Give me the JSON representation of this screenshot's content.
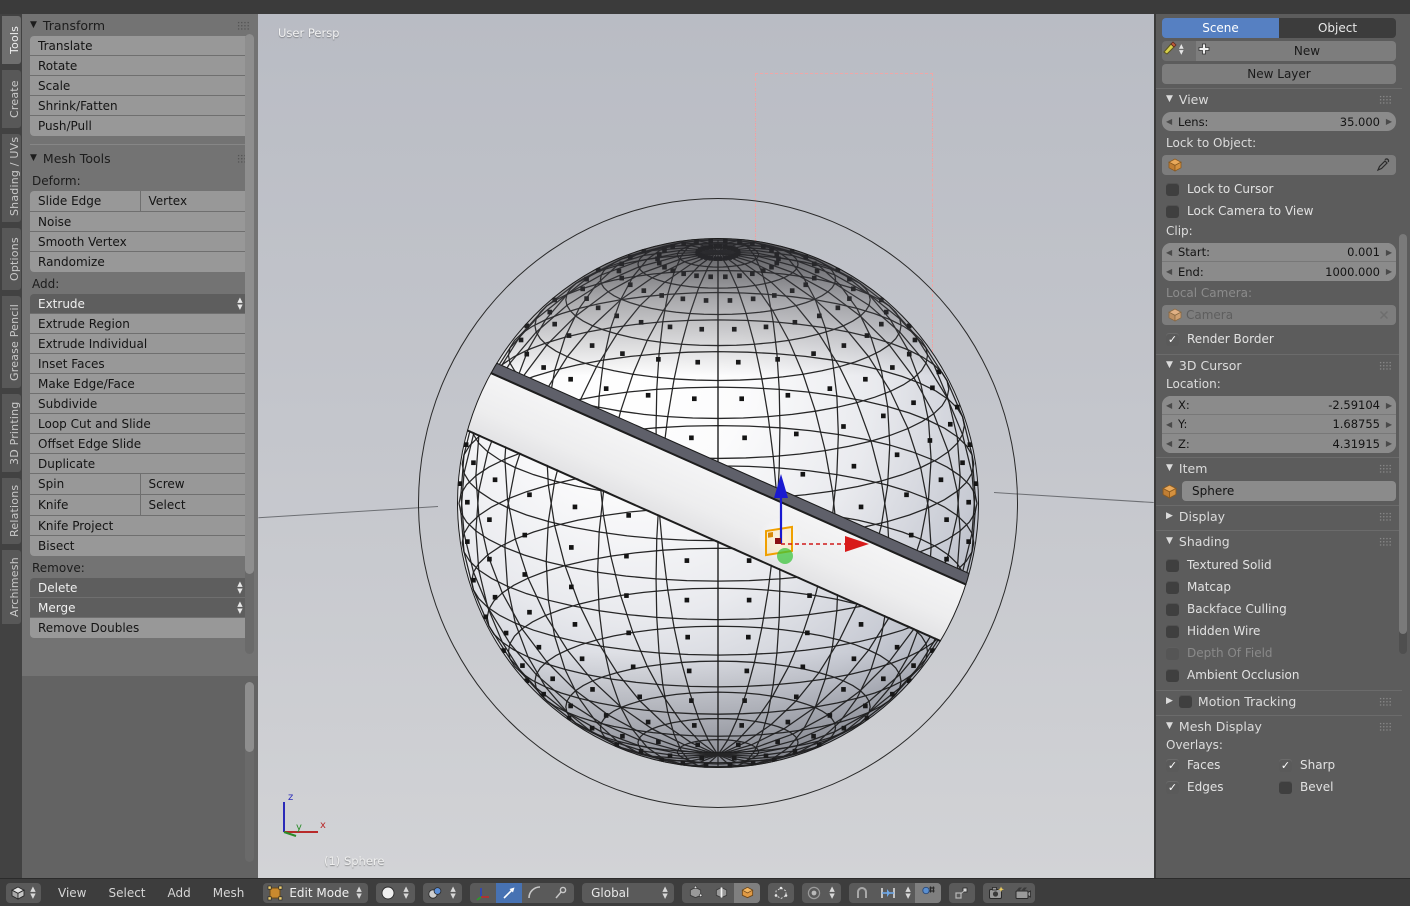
{
  "viewport": {
    "persp_label": "User Persp",
    "object_label": "(1) Sphere",
    "axis": {
      "z": "z",
      "y": "y",
      "x": "x"
    },
    "colors": {
      "axis_x": "#c04040",
      "axis_y": "#3f9e3f",
      "axis_z": "#3a3ac0",
      "render_border": "#e03a3a",
      "select_outline": "#f0a000",
      "background": "#c4c6cc"
    }
  },
  "left_tabs": [
    {
      "label": "Tools",
      "active": true
    },
    {
      "label": "Create",
      "active": false
    },
    {
      "label": "Shading / UVs",
      "active": false
    },
    {
      "label": "Options",
      "active": false
    },
    {
      "label": "Grease Pencil",
      "active": false
    },
    {
      "label": "3D Printing",
      "active": false
    },
    {
      "label": "Relations",
      "active": false
    },
    {
      "label": "Archimesh",
      "active": false
    }
  ],
  "toolshelf": {
    "transform": {
      "title": "Transform",
      "buttons": [
        "Translate",
        "Rotate",
        "Scale",
        "Shrink/Fatten",
        "Push/Pull"
      ]
    },
    "mesh_tools": {
      "title": "Mesh Tools",
      "deform_label": "Deform:",
      "deform_row": [
        "Slide Edge",
        "Vertex"
      ],
      "deform_buttons": [
        "Noise",
        "Smooth Vertex",
        "Randomize"
      ],
      "add_label": "Add:",
      "add_dropdown": "Extrude",
      "add_buttons": [
        "Extrude Region",
        "Extrude Individual",
        "Inset Faces",
        "Make Edge/Face",
        "Subdivide",
        "Loop Cut and Slide",
        "Offset Edge Slide",
        "Duplicate"
      ],
      "add_row1": [
        "Spin",
        "Screw"
      ],
      "add_row2": [
        "Knife",
        "Select"
      ],
      "add_buttons2": [
        "Knife Project",
        "Bisect"
      ],
      "remove_label": "Remove:",
      "remove_dropdowns": [
        "Delete",
        "Merge"
      ],
      "remove_buttons": [
        "Remove Doubles"
      ]
    }
  },
  "properties": {
    "tabs": [
      {
        "label": "Scene",
        "active": true
      },
      {
        "label": "Object",
        "active": false
      }
    ],
    "new_button": "New",
    "new_layer_button": "New Layer",
    "view": {
      "title": "View",
      "lens_label": "Lens:",
      "lens_value": "35.000",
      "lock_to_object_label": "Lock to Object:",
      "lock_to_object_value": "",
      "lock_to_cursor": {
        "label": "Lock to Cursor",
        "checked": false
      },
      "lock_camera_to_view": {
        "label": "Lock Camera to View",
        "checked": false
      },
      "clip_label": "Clip:",
      "clip_start_label": "Start:",
      "clip_start_value": "0.001",
      "clip_end_label": "End:",
      "clip_end_value": "1000.000",
      "local_camera_label": "Local Camera:",
      "local_camera_value": "Camera",
      "render_border": {
        "label": "Render Border",
        "checked": true
      }
    },
    "cursor3d": {
      "title": "3D Cursor",
      "location_label": "Location:",
      "x_label": "X:",
      "x_value": "-2.59104",
      "y_label": "Y:",
      "y_value": "1.68755",
      "z_label": "Z:",
      "z_value": "4.31915"
    },
    "item": {
      "title": "Item",
      "name_value": "Sphere"
    },
    "display": {
      "title": "Display",
      "expanded": false
    },
    "shading": {
      "title": "Shading",
      "options": [
        {
          "label": "Textured Solid",
          "checked": false,
          "disabled": false
        },
        {
          "label": "Matcap",
          "checked": false,
          "disabled": false
        },
        {
          "label": "Backface Culling",
          "checked": false,
          "disabled": false
        },
        {
          "label": "Hidden Wire",
          "checked": false,
          "disabled": false
        },
        {
          "label": "Depth Of Field",
          "checked": false,
          "disabled": true
        },
        {
          "label": "Ambient Occlusion",
          "checked": false,
          "disabled": false
        }
      ]
    },
    "motion_tracking": {
      "title": "Motion Tracking",
      "checked": false
    },
    "mesh_display": {
      "title": "Mesh Display",
      "overlays_label": "Overlays:",
      "overlays": [
        {
          "label": "Faces",
          "checked": true
        },
        {
          "label": "Sharp",
          "checked": true
        },
        {
          "label": "Edges",
          "checked": true
        },
        {
          "label": "Bevel",
          "checked": false
        }
      ]
    }
  },
  "header": {
    "menus": [
      "View",
      "Select",
      "Add",
      "Mesh"
    ],
    "mode": "Edit Mode",
    "transform_orientation": "Global",
    "icons": {
      "editor_type": "editor-type-icon",
      "mode": "edit-mode-icon",
      "shading": "viewport-shading-icon",
      "render_engine": "render-display-icon",
      "manipulator_translate": "translate-manipulator-icon",
      "manipulator_rotate": "rotate-manipulator-icon",
      "manipulator_scale": "scale-manipulator-icon",
      "vertex_select": "vertex-select-icon",
      "edge_select": "edge-select-icon",
      "face_select": "face-select-icon",
      "occlude": "occlude-geometry-icon",
      "proportional_edit": "proportional-edit-icon",
      "snap_magnet": "snap-magnet-icon",
      "snap_target": "snap-target-icon",
      "pivot": "pivot-point-icon",
      "render_image": "render-image-icon",
      "render_animation": "render-animation-icon",
      "opengl_render": "opengl-render-icon"
    }
  }
}
